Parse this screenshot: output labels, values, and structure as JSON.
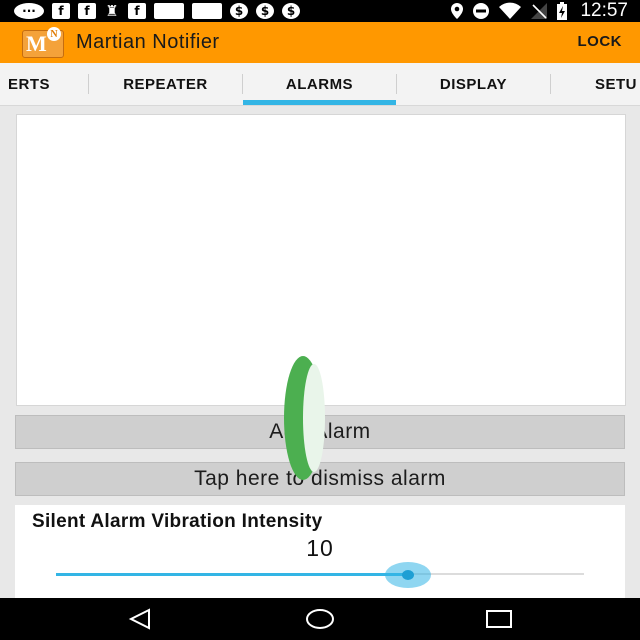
{
  "status_bar": {
    "time": "12:57",
    "left_icons": [
      "keyboard-icon",
      "facebook-icon",
      "facebook-icon",
      "chess-piece-icon",
      "facebook-icon",
      "image-icon",
      "image-icon",
      "dollar-icon",
      "dollar-icon",
      "dollar-icon"
    ],
    "right_icons": [
      "location-icon",
      "do-not-disturb-icon",
      "wifi-icon",
      "no-signal-icon",
      "battery-charging-icon"
    ]
  },
  "app_bar": {
    "title": "Martian Notifier",
    "action": "LOCK",
    "logo": {
      "letter": "M",
      "badge": "N"
    }
  },
  "tabs": [
    {
      "label": "ERTS"
    },
    {
      "label": "REPEATER"
    },
    {
      "label": "ALARMS",
      "selected": true
    },
    {
      "label": "DISPLAY"
    },
    {
      "label": "SETU"
    }
  ],
  "buttons": {
    "add_alarm": "Add Alarm",
    "dismiss_alarm": "Tap here to dismiss alarm"
  },
  "vibration": {
    "title": "Silent Alarm Vibration Intensity",
    "value": "10",
    "slider_fraction": 0.667
  },
  "colors": {
    "app_bar": "#ff9800",
    "accent": "#33b5e5",
    "overlay_green": "#4caf50"
  }
}
